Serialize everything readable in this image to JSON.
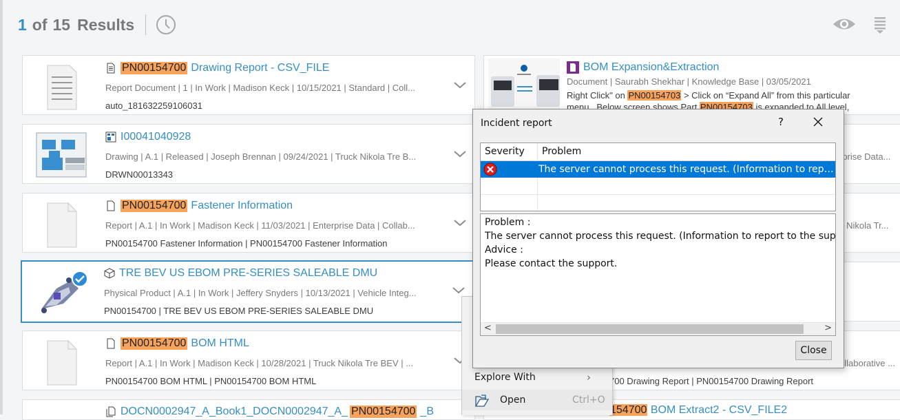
{
  "header": {
    "count": "1",
    "of_label": "of",
    "total": "15",
    "results_label": "Results"
  },
  "icons": [
    "clock-icon",
    "eye-icon",
    "sort-list-icon",
    "document-icon",
    "drawing-icon",
    "blank-page-icon",
    "physical-product-icon",
    "bom-icon",
    "chevron-down-icon",
    "error-icon",
    "close-icon",
    "open-icon"
  ],
  "colors": {
    "accent": "#368ec4",
    "highlight": "#f7a35c",
    "selection": "#0078d7"
  },
  "results": [
    {
      "highlight": "PN00154700",
      "title": "Drawing Report - CSV_FILE",
      "meta": "Report Document | 1 | In Work | Madison Keck | 10/15/2021 | Standard | Coll...",
      "sub": "auto_181632259106031"
    },
    {
      "highlight": "",
      "title": "I00041040928",
      "meta": "Drawing | A.1 | Released | Joseph Brennan | 09/24/2021 | Truck Nikola Tre B...",
      "sub": "DRWN00013343"
    },
    {
      "highlight": "PN00154700",
      "title": "Fastener Information",
      "meta": "Report | A.1 | In Work | Madison Keck | 11/03/2021 | Enterprise Data | Collab...",
      "sub": "PN00154700 Fastener Information | PN00154700 Fastener Information"
    },
    {
      "highlight": "",
      "title": "TRE BEV US EBOM PRE-SERIES SALEABLE DMU",
      "meta": "Physical Product | A.1 | In Work | Jeffery Snyders | 10/13/2021 | Vehicle Integ...",
      "sub": "PN00154700 | TRE BEV US EBOM PRE-SERIES SALEABLE DMU"
    },
    {
      "highlight": "PN00154700",
      "title": "BOM HTML",
      "meta": "Report | A.1 | In Work | Madison Keck | 10/28/2021 | Truck Nikola Tre BEV | ...",
      "sub": "PN00154700 BOM HTML | PN00154700 BOM HTML"
    },
    {
      "title_pre": "DOCN0002947_A_Book1_DOCN0002947_A_",
      "highlight": "PN00154700",
      "title_post": "_B"
    }
  ],
  "right_card": {
    "title": "BOM Expansion&Extraction",
    "meta": "Document | Saurabh Shekhar | Knowledge Base | 03/05/2021",
    "desc1_a": "Right Click\" on ",
    "desc1_hl": "PN00154703",
    "desc1_b": " > Click on “Expand All” from this particular",
    "desc2_a": "menu...Below screen shows Part ",
    "desc2_hl": "PN00154703",
    "desc2_b": " is expanded to All level,"
  },
  "right_fragments": {
    "r2": "rprise Data...",
    "r3": "k Nikola Tr...",
    "r5": "ollaborative ...",
    "r5sub": "700 Drawing Report | PN00154700 Drawing Report",
    "r6_hl": "154700",
    "r6_title": " BOM Extract2 - CSV_FILE2"
  },
  "context_menu": {
    "explore_label": "Explore With",
    "explore_arrow": "›",
    "open_label": "Open",
    "open_shortcut": "Ctrl+O"
  },
  "dialog": {
    "title": "Incident report",
    "help": "?",
    "col_severity": "Severity",
    "col_problem": "Problem",
    "row_problem": "The server cannot process this request. (Information to report to the support",
    "detail_line1": "Problem :",
    "detail_line2": "The server cannot process this request. (Information to report to the support",
    "detail_line3": "Advice :",
    "detail_line4": "Please contact the support.",
    "scroll_left": "<",
    "scroll_right": ">",
    "close_label": "Close"
  }
}
